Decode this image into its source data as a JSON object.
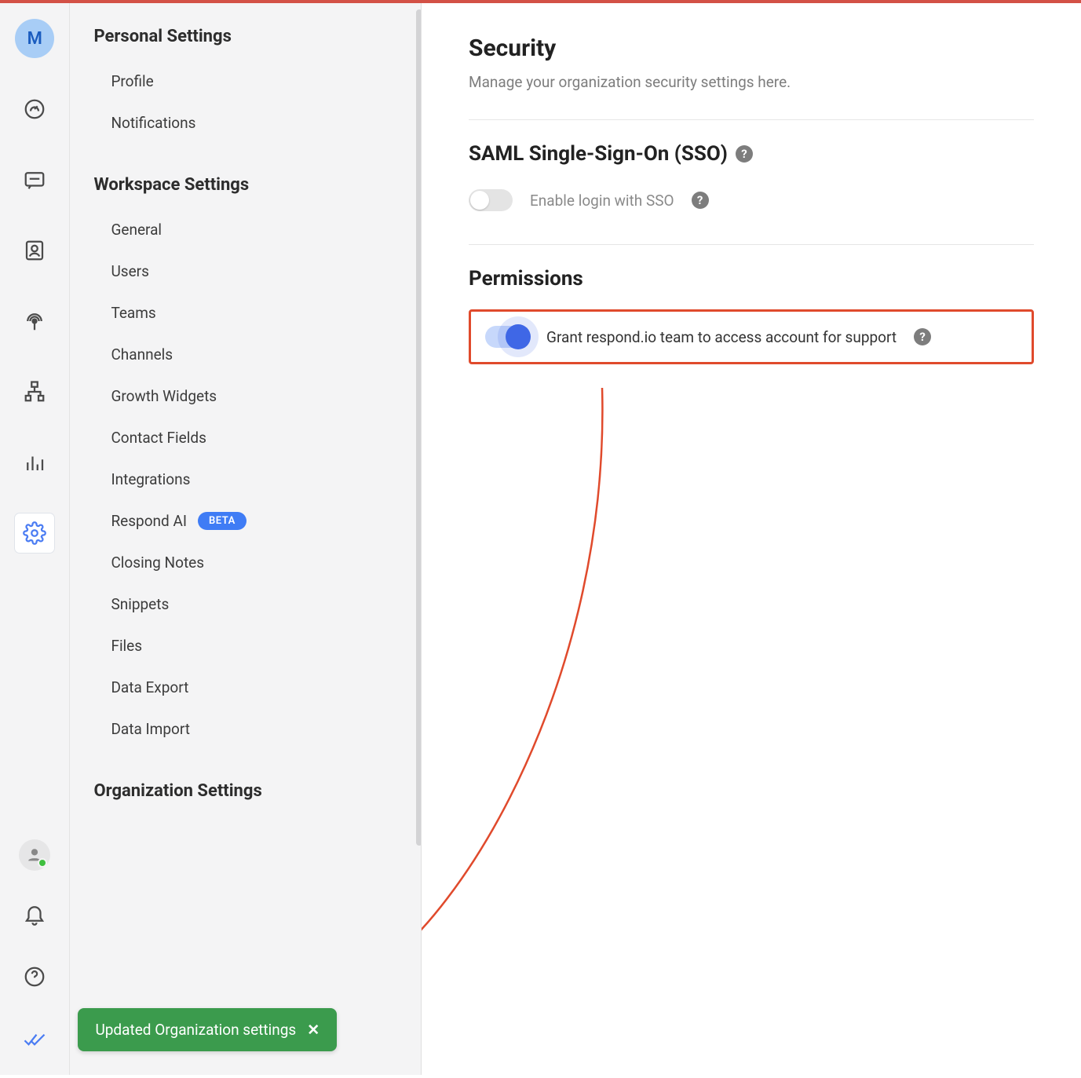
{
  "rail": {
    "avatar_letter": "M"
  },
  "sidebar": {
    "groups": [
      {
        "title": "Personal Settings",
        "items": [
          {
            "label": "Profile"
          },
          {
            "label": "Notifications"
          }
        ]
      },
      {
        "title": "Workspace Settings",
        "items": [
          {
            "label": "General"
          },
          {
            "label": "Users"
          },
          {
            "label": "Teams"
          },
          {
            "label": "Channels"
          },
          {
            "label": "Growth Widgets"
          },
          {
            "label": "Contact Fields"
          },
          {
            "label": "Integrations"
          },
          {
            "label": "Respond AI",
            "badge": "BETA"
          },
          {
            "label": "Closing Notes"
          },
          {
            "label": "Snippets"
          },
          {
            "label": "Files"
          },
          {
            "label": "Data Export"
          },
          {
            "label": "Data Import"
          }
        ]
      },
      {
        "title": "Organization Settings",
        "items": []
      }
    ],
    "toast": {
      "text": "Updated Organization settings",
      "close_glyph": "✕"
    }
  },
  "main": {
    "title": "Security",
    "description": "Manage your organization security settings here.",
    "sso": {
      "heading": "SAML Single-Sign-On (SSO)",
      "toggle_label": "Enable login with SSO",
      "enabled": false
    },
    "permissions": {
      "heading": "Permissions",
      "toggle_label": "Grant respond.io team to access account for support",
      "enabled": true
    }
  },
  "colors": {
    "accent_blue": "#3f67e6",
    "highlight_red": "#e04a2c",
    "toast_green": "#3b9b4d"
  }
}
